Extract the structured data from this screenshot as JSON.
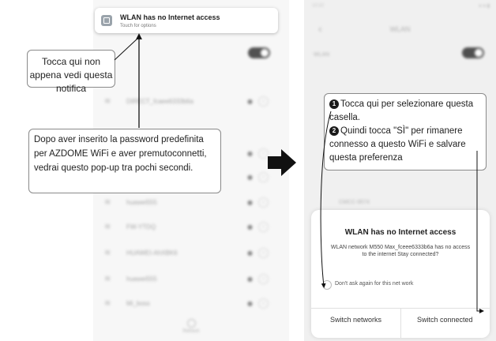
{
  "notification": {
    "title": "WLAN has no Internet access",
    "subtitle": "Touch for options"
  },
  "callouts": {
    "tap_notification": "Tocca qui non appena vedi questa notifica",
    "popup_info": "Dopo aver inserito la password predefinita per AZDOME WiFi e aver premutoconnetti, vedrai questo pop-up tra pochi secondi.",
    "step1": "Tocca qui per selezionare questa casella.",
    "step2": "Quindi tocca \"SÌ\" per rimanere connesso a questo WiFi e salvare questa preferenza",
    "step1_num": "1",
    "step2_num": "2"
  },
  "left_phone": {
    "wlan_label": "WLAN",
    "networks": [
      {
        "name": "DIRECT_fcaee6333b6a",
        "locked": true
      },
      {
        "name": "huawei555",
        "locked": true
      },
      {
        "name": "FW-YTDQ",
        "locked": true
      },
      {
        "name": "HUAWEI-AhXBK6",
        "locked": true
      },
      {
        "name": "huawei555",
        "locked": true
      },
      {
        "name": "Mi_boss",
        "locked": true
      }
    ],
    "refresh_label": "Refresh"
  },
  "right_phone": {
    "title": "WLAN",
    "wlan_label": "WLAN",
    "network_faint": "CMCC-9574"
  },
  "dialog": {
    "title": "WLAN has no Internet access",
    "message": "WLAN network M550 Max_fceee6333b6a has no access to the internet Stay connected?",
    "checkbox_label": "Don't ask again for this net work",
    "switch_networks": "Switch networks",
    "switch_connected": "Switch connected"
  },
  "colors": {
    "arrow": "#111111",
    "toggle": "#1a1a1a",
    "callout_border": "#8a8a8a"
  }
}
